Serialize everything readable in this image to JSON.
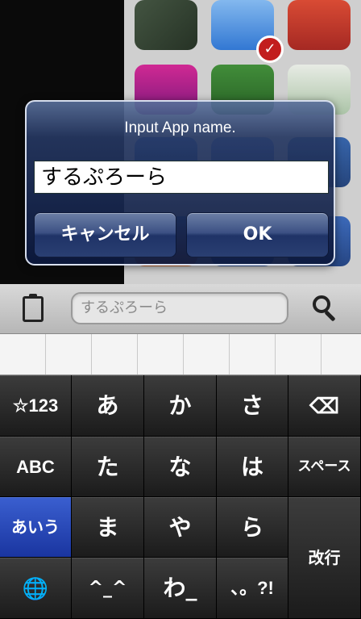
{
  "dialog": {
    "title": "Input App name.",
    "input_value": "するぷろーら",
    "cancel_label": "キャンセル",
    "ok_label": "OK"
  },
  "toolbar": {
    "search_value": "するぷろーら"
  },
  "keyboard": {
    "row1": [
      "☆123",
      "あ",
      "か",
      "さ",
      "⌫"
    ],
    "row2": [
      "ABC",
      "た",
      "な",
      "は",
      "スペース"
    ],
    "row3": [
      "あいう",
      "ま",
      "や",
      "ら"
    ],
    "row4": [
      "🌐",
      "^_^",
      "わ_",
      "、。?!"
    ],
    "enter_label": "改行"
  },
  "icons": {
    "clipboard": "clipboard-icon",
    "search": "search-icon",
    "globe": "globe-icon",
    "delete": "delete-icon"
  },
  "colors": {
    "dialog_bg": "#1a2a5a",
    "keyboard_active": "#2344b8"
  }
}
